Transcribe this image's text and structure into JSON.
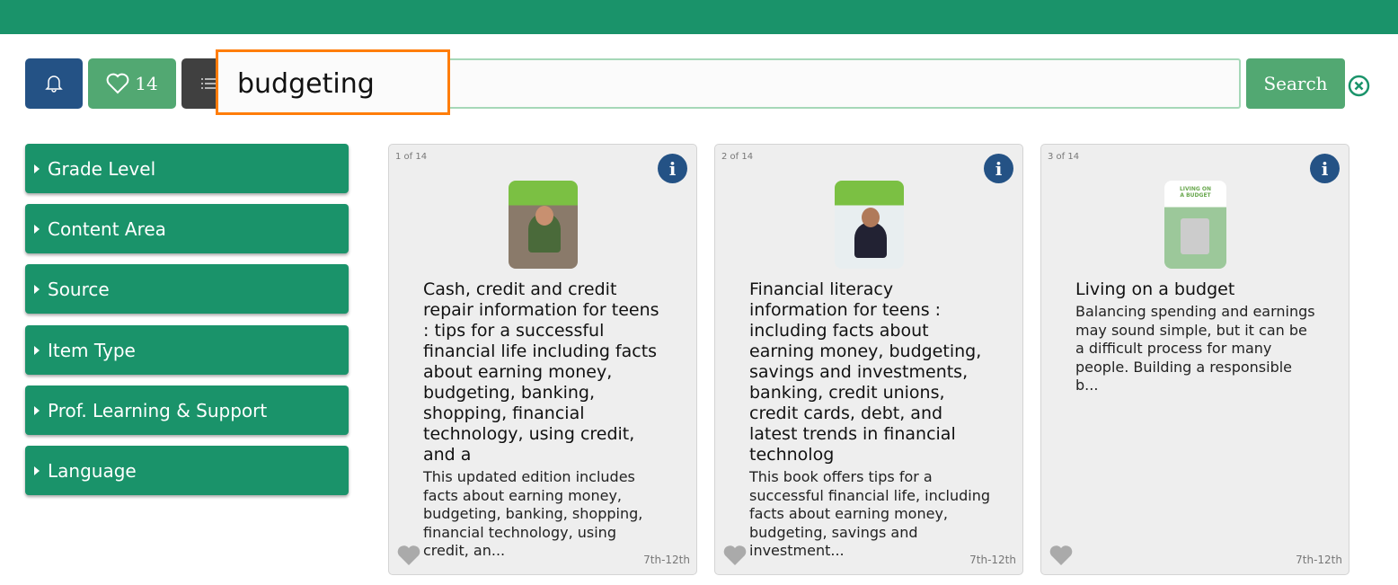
{
  "header": {
    "favorites_count": "14"
  },
  "search": {
    "query": "budgeting",
    "button_label": "Search"
  },
  "facets": [
    "Grade Level",
    "Content Area",
    "Source",
    "Item Type",
    "Prof. Learning & Support",
    "Language"
  ],
  "results": [
    {
      "count": "1 of 14",
      "title": "Cash, credit and credit repair information for teens : tips for a successful financial life including facts about earning money, budgeting, banking, shopping, financial technology, using credit, and a",
      "description": "This updated edition includes facts about earning money, budgeting, banking, shopping, financial technology, using credit, an...",
      "grade": "7th-12th"
    },
    {
      "count": "2 of 14",
      "title": "Financial literacy information for teens : including facts about earning money, budgeting, savings and investments, banking, credit unions, credit cards, debt, and latest trends in financial technolog",
      "description": "This book offers tips for a successful financial life, including facts about earning money, budgeting, savings and investment...",
      "grade": "7th-12th"
    },
    {
      "count": "3 of 14",
      "title": "Living on a budget",
      "description": "Balancing spending and earnings may sound simple, but it can be a difficult process for many people. Building a responsible b...",
      "grade": "7th-12th",
      "cover_text": "LIVING ON A BUDGET"
    }
  ]
}
